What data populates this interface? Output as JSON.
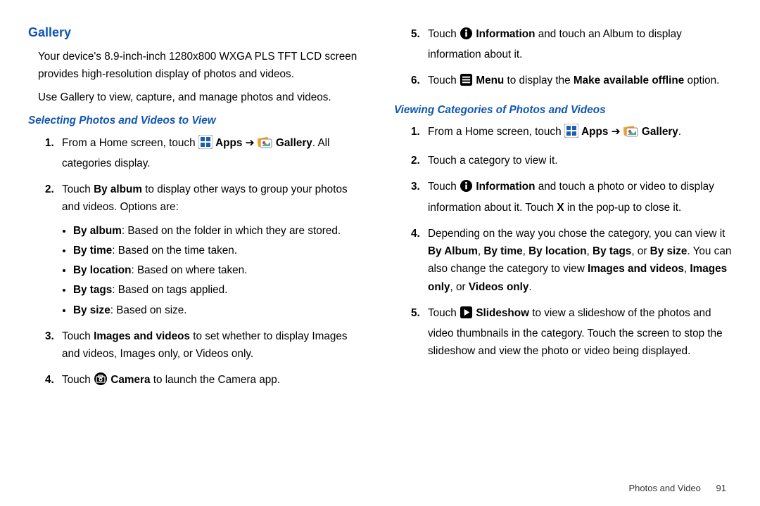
{
  "left": {
    "heading": "Gallery",
    "intro1": "Your device's 8.9-inch-inch 1280x800 WXGA PLS TFT LCD screen provides high-resolution display of photos and videos.",
    "intro2": "Use Gallery to view, capture, and manage photos and videos.",
    "subheading": "Selecting Photos and Videos to View",
    "s1_a": "From a Home screen, touch ",
    "s1_apps": "Apps",
    "s1_arrow": " ➔ ",
    "s1_gallery": "Gallery",
    "s1_tail": ". All categories display.",
    "s2_a": "Touch ",
    "s2_b": "By album",
    "s2_c": " to display other ways to group your photos and videos. Options are:",
    "bul1a": "By album",
    "bul1b": ": Based on the folder in which they are stored.",
    "bul2a": "By time",
    "bul2b": ": Based on the time taken.",
    "bul3a": "By location",
    "bul3b": ": Based on where taken.",
    "bul4a": "By tags",
    "bul4b": ": Based on tags applied.",
    "bul5a": "By size",
    "bul5b": ": Based on size.",
    "s3_a": "Touch ",
    "s3_b": "Images and videos",
    "s3_c": " to set whether to display Images and videos, Images only, or Videos only.",
    "s4_a": "Touch ",
    "s4_b": "Camera",
    "s4_c": " to launch the Camera app."
  },
  "right": {
    "s5_a": "Touch ",
    "s5_b": "Information",
    "s5_c": " and touch an Album to display information about it.",
    "s6_a": "Touch ",
    "s6_b": "Menu",
    "s6_c": " to display the ",
    "s6_d": "Make available offline",
    "s6_e": " option.",
    "subheading": "Viewing Categories of Photos and Videos",
    "v1_a": "From a Home screen, touch ",
    "v1_apps": "Apps",
    "v1_arrow": " ➔ ",
    "v1_gallery": "Gallery",
    "v1_tail": ".",
    "v2": "Touch a category to view it.",
    "v3_a": "Touch ",
    "v3_b": "Information",
    "v3_c": " and touch a photo or video to display information about it. Touch ",
    "v3_d": "X",
    "v3_e": " in the pop-up to close it.",
    "v4_a": "Depending on the way you chose the category, you can view it ",
    "v4_b": "By Album",
    "v4_c": ", ",
    "v4_d": "By time",
    "v4_e": ", ",
    "v4_f": "By location",
    "v4_g": ", ",
    "v4_h": "By tags",
    "v4_i": ", or ",
    "v4_j": "By size",
    "v4_k": ". You can also change the category to view ",
    "v4_l": "Images and videos",
    "v4_m": ", ",
    "v4_n": "Images only",
    "v4_o": ", or ",
    "v4_p": "Videos only",
    "v4_q": ".",
    "v5_a": "Touch ",
    "v5_b": "Slideshow",
    "v5_c": " to view a slideshow of the photos and video thumbnails in the category. Touch the screen to stop the slideshow and view the photo or video being displayed."
  },
  "footer": {
    "section": "Photos and Video",
    "page": "91"
  }
}
